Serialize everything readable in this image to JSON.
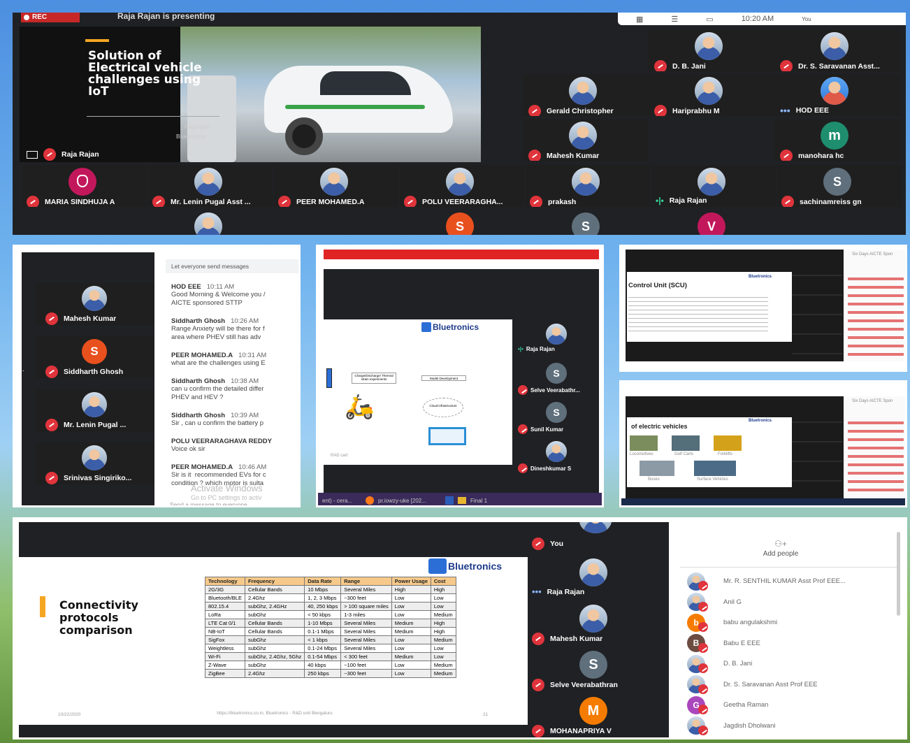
{
  "top_meeting": {
    "rec_label": "REC",
    "presenting_label": "Raja Rajan is presenting",
    "time": "10:20 AM",
    "you_label": "You",
    "slide": {
      "title": "Solution of Electrical vehicle challenges using IoT",
      "author": "Rajarajan",
      "company": "Bluetronics"
    },
    "presenter_name": "Raja Rajan",
    "participants_right": [
      {
        "name": "D. B. Jani",
        "status": "muted",
        "avatar": "photo"
      },
      {
        "name": "Dr. S. Saravanan Asst...",
        "status": "muted",
        "avatar": "photo"
      },
      {
        "name": "Gerald Christopher",
        "status": "muted",
        "avatar": "photo"
      },
      {
        "name": "Hariprabhu M",
        "status": "muted",
        "avatar": "photo"
      },
      {
        "name": "HOD EEE",
        "status": "dots",
        "avatar": "photo"
      },
      {
        "name": "Mahesh Kumar",
        "status": "muted",
        "avatar": "photo"
      },
      {
        "name": "manohara hc",
        "status": "muted",
        "avatar": "m"
      }
    ],
    "participants_bottom": [
      {
        "name": "MARIA SINDHUJA A",
        "avatar": "logo"
      },
      {
        "name": "Mr. Lenin Pugal Asst ...",
        "avatar": "photo"
      },
      {
        "name": "PEER MOHAMED.A",
        "avatar": "photo"
      },
      {
        "name": "POLU VEERARAGHA...",
        "avatar": "photo"
      },
      {
        "name": "prakash",
        "avatar": "photo"
      },
      {
        "name": "Raja Rajan",
        "avatar": "photo",
        "status": "speaking"
      },
      {
        "name": "sachinamreiss gn",
        "avatar": "S"
      }
    ],
    "partial_row": [
      "S",
      "S",
      "V"
    ]
  },
  "chat_panel": {
    "participants": [
      {
        "name": "Mahesh Kumar",
        "avatar": "photo"
      },
      {
        "name": "Siddharth Ghosh",
        "avatar": "S"
      },
      {
        "name": "Mr. Lenin Pugal ...",
        "avatar": "photo"
      },
      {
        "name": "Srinivas Singiriko...",
        "avatar": "photo"
      }
    ],
    "left_cut": "hr...",
    "header": "Let everyone send messages",
    "messages": [
      {
        "author": "HOD EEE",
        "time": "10:11 AM",
        "text": "Good Morning & Welcome you /\nAICTE sponsored STTP"
      },
      {
        "author": "Siddharth Ghosh",
        "time": "10:26 AM",
        "text": "Range Anxiety will be there for f\narea where PHEV still has adv"
      },
      {
        "author": "PEER MOHAMED.A",
        "time": "10:31 AM",
        "text": "what are the challenges using E"
      },
      {
        "author": "Siddharth Ghosh",
        "time": "10:38 AM",
        "text": "can u confirm the detailed differ\nPHEV and HEV ?"
      },
      {
        "author": "Siddharth Ghosh",
        "time": "10:39 AM",
        "text": "Sir , can u confirm the battery p"
      },
      {
        "author": "POLU VEERARAGHAVA REDDY",
        "time": "",
        "text": "Voice ok sir"
      },
      {
        "author": "PEER MOHAMED.A",
        "time": "10:46 AM",
        "text": "Sir is it  recommended EVs for c\ncondition ? which motor is sulta"
      }
    ],
    "watermark_1": "Activate Windows",
    "watermark_2": "Go to PC settings to activ",
    "input_placeholder": "Send a message to everyone"
  },
  "diagram_panel": {
    "brand": "Bluetronics",
    "boxes": [
      "Charge/Discharge/ Thermal strain experiments",
      "Model Development",
      "Cloud infrastructure"
    ],
    "footer_left": "RAD cart",
    "participants": [
      {
        "name": "Raja Rajan",
        "avatar": "photo",
        "status": "speaking"
      },
      {
        "name": "Selve Veerabathr...",
        "avatar": "S"
      },
      {
        "name": "Sunil Kumar",
        "avatar": "S"
      },
      {
        "name": "Dineshkumar S",
        "avatar": "photo"
      }
    ],
    "taskbar": [
      "ent) - cera...",
      "pr.iowzy-uke [202...",
      "Final 1"
    ]
  },
  "screen_a": {
    "heading": "Control Unit (SCU)",
    "brand": "Bluetronics",
    "header": "Six Days AICTE Spon"
  },
  "screen_b": {
    "heading": "of electric vehicles",
    "brand": "Bluetronics",
    "header": "Six Days AICTE Spon",
    "captions": [
      "Locomotives",
      "Golf Carts",
      "Forklifts",
      "Buses",
      "Surface Vehicles"
    ]
  },
  "bottom_meeting": {
    "slide_title": "Connectivity protocols comparison",
    "brand": "Bluetronics",
    "date": "10/22/2020",
    "footer_url": "https://bluetronics.co.in, Bluetronics - R&D unit Bengaluru",
    "page_no": "21",
    "table_headers": [
      "Technology",
      "Frequency",
      "Data Rate",
      "Range",
      "Power Usage",
      "Cost"
    ],
    "table_rows": [
      [
        "2G/3G",
        "Cellular Bands",
        "10 Mbps",
        "Several Miles",
        "High",
        "High"
      ],
      [
        "Bluetooth/BLE",
        "2.4Ghz",
        "1, 2, 3 Mbps",
        "~300 feet",
        "Low",
        "Low"
      ],
      [
        "802.15.4",
        "subGhz, 2.4GHz",
        "40, 250 kbps",
        "> 100 square miles",
        "Low",
        "Low"
      ],
      [
        "LoRa",
        "subGhz",
        "< 50 kbps",
        "1-3 miles",
        "Low",
        "Medium"
      ],
      [
        "LTE Cat 0/1",
        "Cellular Bands",
        "1-10 Mbps",
        "Several Miles",
        "Medium",
        "High"
      ],
      [
        "NB-IoT",
        "Cellular Bands",
        "0.1-1 Mbps",
        "Several Miles",
        "Medium",
        "High"
      ],
      [
        "SigFox",
        "subGhz",
        "< 1 kbps",
        "Several Miles",
        "Low",
        "Medium"
      ],
      [
        "Weightless",
        "subGhz",
        "0.1-24 Mbps",
        "Several Miles",
        "Low",
        "Low"
      ],
      [
        "Wi-Fi",
        "subGhz, 2.4Ghz, 5Ghz",
        "0.1-54 Mbps",
        "< 300 feet",
        "Medium",
        "Low"
      ],
      [
        "Z-Wave",
        "subGhz",
        "40 kbps",
        "~100 feet",
        "Low",
        "Medium"
      ],
      [
        "ZigBee",
        "2.4Ghz",
        "250 kbps",
        "~300 feet",
        "Low",
        "Medium"
      ]
    ],
    "tiles": [
      {
        "name": "You",
        "avatar": "photo",
        "status": "muted"
      },
      {
        "name": "Raja Rajan",
        "avatar": "photo",
        "status": "dots"
      },
      {
        "name": "Mahesh Kumar",
        "avatar": "photo",
        "status": "muted"
      },
      {
        "name": "Selve Veerabathran",
        "avatar": "S",
        "status": "muted"
      },
      {
        "name": "MOHANAPRIYA V",
        "avatar": "M",
        "status": "muted"
      }
    ],
    "add_people": "Add people",
    "people": [
      {
        "name": "Mr. R. SENTHIL KUMAR Asst Prof EEE...",
        "avatar": "photo"
      },
      {
        "name": "Anil G",
        "avatar": "photo"
      },
      {
        "name": "babu angulakshmi",
        "avatar": "b"
      },
      {
        "name": "Babu E EEE",
        "avatar": "B"
      },
      {
        "name": "D. B. Jani",
        "avatar": "photo"
      },
      {
        "name": "Dr. S. Saravanan Asst Prof EEE",
        "avatar": "photo"
      },
      {
        "name": "Geetha Raman",
        "avatar": "G"
      },
      {
        "name": "Jagdish Dholwani",
        "avatar": "photo"
      }
    ]
  }
}
